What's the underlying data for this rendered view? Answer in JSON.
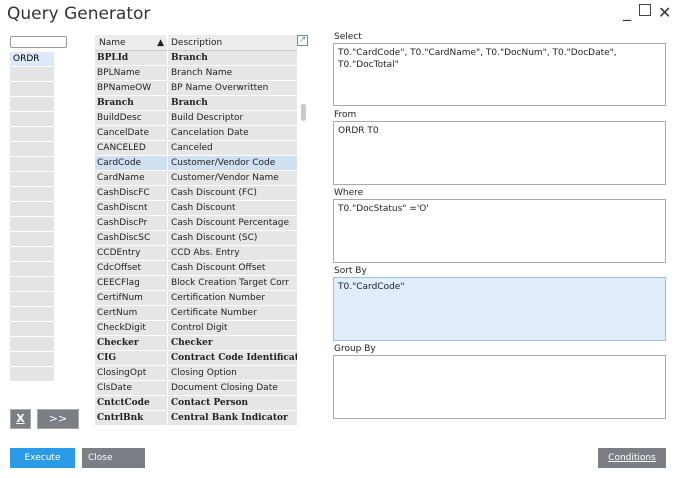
{
  "window": {
    "title": "Query Generator",
    "minimize": "_",
    "close": "✕"
  },
  "tables": {
    "search_value": "",
    "items": [
      "ORDR"
    ]
  },
  "fields": {
    "header_name": "Name",
    "header_desc": "Description",
    "rows": [
      {
        "name": "BPLId",
        "desc": "Branch",
        "bold": true
      },
      {
        "name": "BPLName",
        "desc": "Branch Name",
        "bold": false
      },
      {
        "name": "BPNameOW",
        "desc": "BP Name Overwritten",
        "bold": false
      },
      {
        "name": "Branch",
        "desc": "Branch",
        "bold": true
      },
      {
        "name": "BuildDesc",
        "desc": "Build Descriptor",
        "bold": false
      },
      {
        "name": "CancelDate",
        "desc": "Cancelation Date",
        "bold": false
      },
      {
        "name": "CANCELED",
        "desc": "Canceled",
        "bold": false
      },
      {
        "name": "CardCode",
        "desc": "Customer/Vendor Code",
        "bold": false,
        "selected": true
      },
      {
        "name": "CardName",
        "desc": "Customer/Vendor Name",
        "bold": false
      },
      {
        "name": "CashDiscFC",
        "desc": "Cash Discount (FC)",
        "bold": false
      },
      {
        "name": "CashDiscnt",
        "desc": "Cash Discount",
        "bold": false
      },
      {
        "name": "CashDiscPr",
        "desc": "Cash Discount Percentage",
        "bold": false
      },
      {
        "name": "CashDiscSC",
        "desc": "Cash Discount (SC)",
        "bold": false
      },
      {
        "name": "CCDEntry",
        "desc": "CCD Abs. Entry",
        "bold": false
      },
      {
        "name": "CdcOffset",
        "desc": "Cash Discount Offset",
        "bold": false
      },
      {
        "name": "CEECFlag",
        "desc": "Block Creation Target Corr",
        "bold": false
      },
      {
        "name": "CertifNum",
        "desc": "Certification Number",
        "bold": false
      },
      {
        "name": "CertNum",
        "desc": "Certificate Number",
        "bold": false
      },
      {
        "name": "CheckDigit",
        "desc": "Control Digit",
        "bold": false
      },
      {
        "name": "Checker",
        "desc": "Checker",
        "bold": true
      },
      {
        "name": "CIG",
        "desc": "Contract Code Identificat",
        "bold": true
      },
      {
        "name": "ClosingOpt",
        "desc": "Closing Option",
        "bold": false
      },
      {
        "name": "ClsDate",
        "desc": "Document Closing Date",
        "bold": false
      },
      {
        "name": "CntctCode",
        "desc": "Contact Person",
        "bold": true
      },
      {
        "name": "CntrlBnk",
        "desc": "Central Bank Indicator",
        "bold": true
      }
    ]
  },
  "query": {
    "select_label": "Select",
    "select_value": "T0.\"CardCode\", T0.\"CardName\", T0.\"DocNum\", T0.\"DocDate\", T0.\"DocTotal\"",
    "from_label": "From",
    "from_value": "ORDR T0",
    "where_label": "Where",
    "where_value": "T0.\"DocStatus\" ='O'",
    "sortby_label": "Sort By",
    "sortby_value": "T0.\"CardCode\"",
    "groupby_label": "Group By",
    "groupby_value": ""
  },
  "buttons": {
    "remove": "X",
    "add": ">>",
    "execute": "Execute",
    "close": "Close",
    "conditions": "Conditions"
  }
}
